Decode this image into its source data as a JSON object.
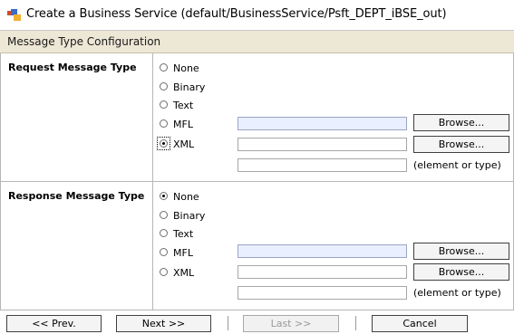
{
  "title": "Create a Business Service (default/BusinessService/Psft_DEPT_iBSE_out)",
  "section": "Message Type Configuration",
  "request": {
    "label": "Request Message Type",
    "options": [
      "None",
      "Binary",
      "Text",
      "MFL",
      "XML"
    ],
    "selected": "XML",
    "mfl_value": "",
    "xml_value": "",
    "element_value": "",
    "browse_label": "Browse...",
    "hint": "(element or type)"
  },
  "response": {
    "label": "Response Message Type",
    "options": [
      "None",
      "Binary",
      "Text",
      "MFL",
      "XML"
    ],
    "selected": "None",
    "mfl_value": "",
    "xml_value": "",
    "element_value": "",
    "browse_label": "Browse...",
    "hint": "(element or type)"
  },
  "footer": {
    "prev": "<< Prev.",
    "next": "Next >>",
    "last": "Last >>",
    "cancel": "Cancel"
  }
}
